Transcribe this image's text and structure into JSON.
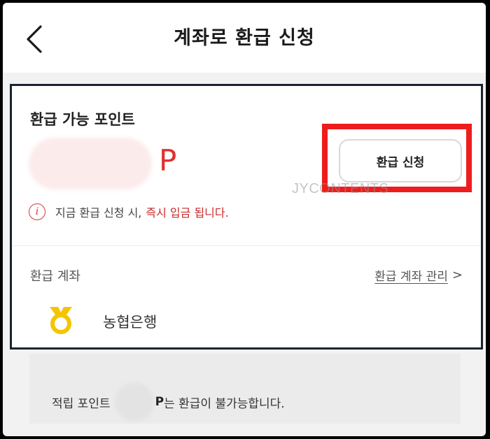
{
  "header": {
    "title": "계좌로 환급 신청",
    "back_icon": "chevron-left-icon"
  },
  "points_section": {
    "title": "환급 가능 포인트",
    "unit": "P",
    "refund_button_label": "환급 신청",
    "notice_icon": "info-icon",
    "notice_icon_glyph": "i",
    "notice_text": "지금 환급 신청 시,",
    "notice_emphasis": "즉시 입금 됩니다."
  },
  "watermark": "JYCONTENTS",
  "account_section": {
    "label": "환급 계좌",
    "manage_link": "환급 계좌 관리",
    "manage_chevron": ">",
    "bank_name": "농협은행",
    "bank_icon": "nonghyup-logo-icon"
  },
  "footer": {
    "prefix": "적립 포인트",
    "unit": "P",
    "suffix": "는 환급이 불가능합니다."
  },
  "colors": {
    "accent_red": "#e03030",
    "highlight_red": "#ee1c1c",
    "card_border": "#1c2330",
    "bank_yellow": "#f5c400"
  }
}
